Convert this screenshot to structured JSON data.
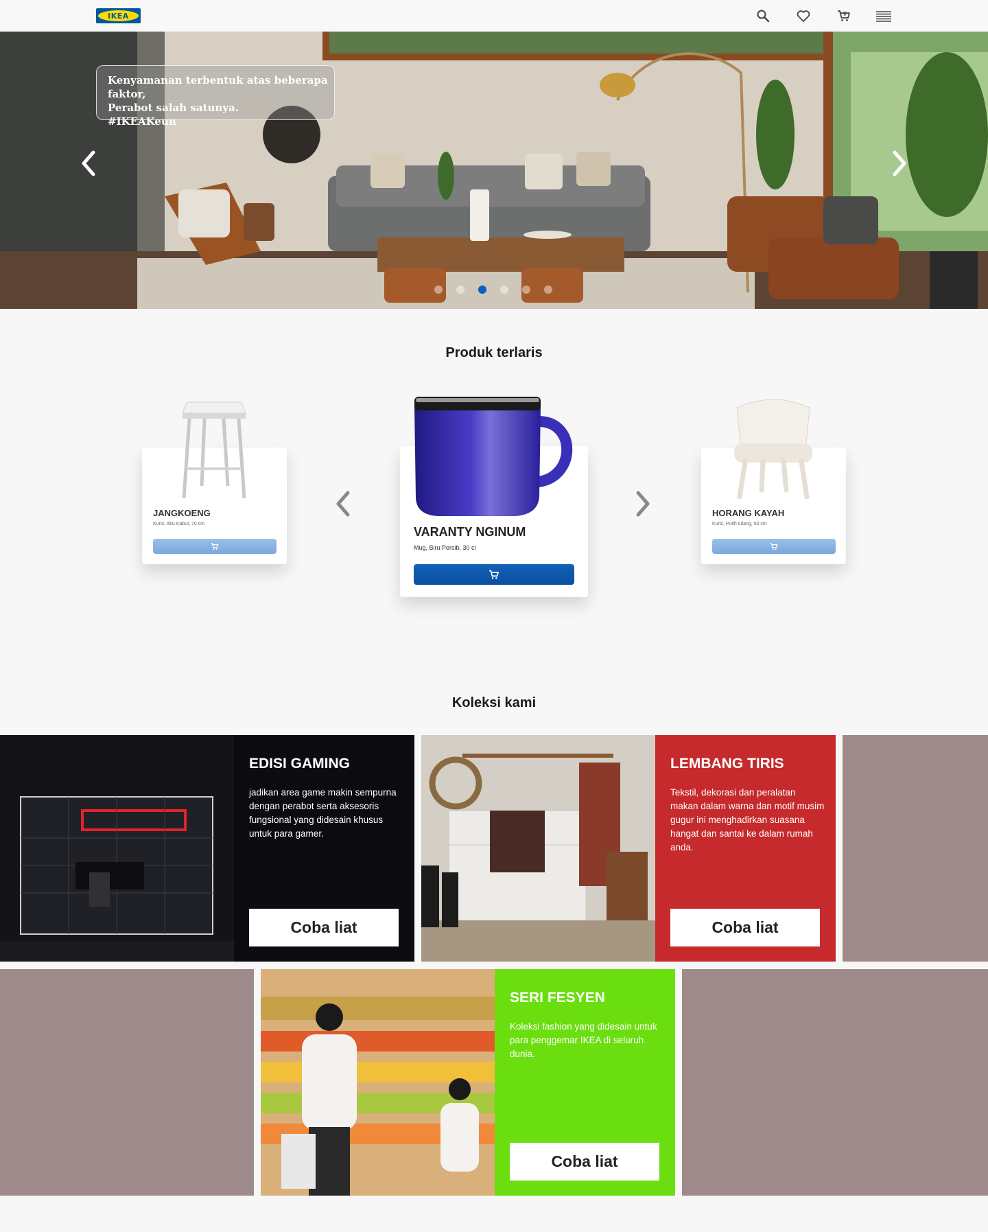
{
  "header": {
    "logo_text": "IKEA",
    "icons": [
      "search-icon",
      "heart-icon",
      "cart-icon",
      "menu-icon"
    ]
  },
  "hero": {
    "caption_lines": [
      "Kenyamanan terbentuk atas beberapa faktor,",
      "Perabot salah satunya.",
      "#IKEAKeun"
    ],
    "slide_count": 6,
    "active_slide": 3
  },
  "bestsellers": {
    "title": "Produk terlaris",
    "products": [
      {
        "name": "JANGKOENG",
        "desc": "Kursi, Abu Kabut, 70 cm"
      },
      {
        "name": "VARANTY NGINUM",
        "desc": "Mug, Biru Persib, 30 cl"
      },
      {
        "name": "HORANG KAYAH",
        "desc": "Kursi, Putih tulang, 50 cm"
      }
    ]
  },
  "collections": {
    "title": "Koleksi kami",
    "items": [
      {
        "title": "EDISI GAMING",
        "desc": "jadikan area game makin sempurna dengan perabot serta aksesoris fungsional yang didesain khusus untuk para gamer.",
        "button": "Coba liat",
        "color": "#0c0b10"
      },
      {
        "title": "LEMBANG TIRIS",
        "desc": "Tekstil, dekorasi dan peralatan makan dalam warna dan motif musim gugur ini menghadirkan suasana hangat dan santai ke dalam rumah anda.",
        "button": "Coba liat",
        "color": "#c62a2c"
      },
      {
        "title": "SERI FESYEN",
        "desc": "Koleksi fashion yang didesain untuk para penggemar IKEA di seluruh dunia.",
        "button": "Coba liat",
        "color": "#6bde10"
      }
    ],
    "filler_color": "#9e8a8a"
  }
}
